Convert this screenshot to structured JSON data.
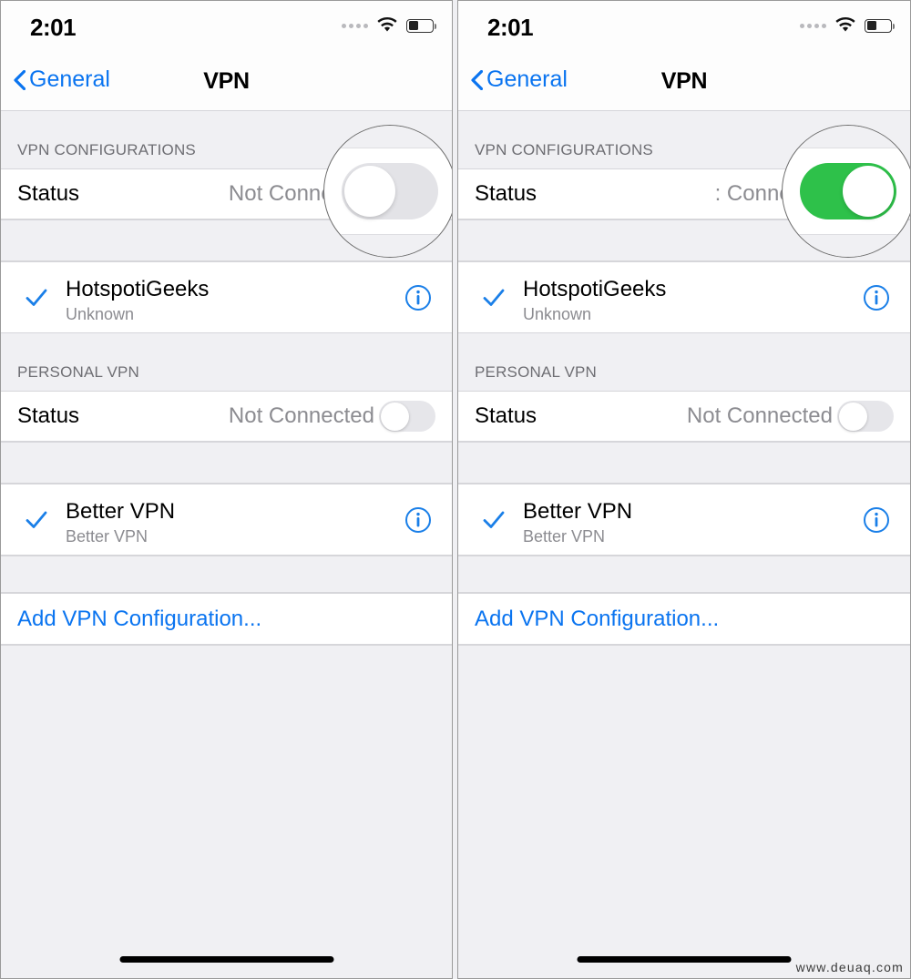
{
  "watermark": "www.deuaq.com",
  "panels": [
    {
      "id": "before",
      "statusbar": {
        "time": "2:01",
        "signal_icon": "signal-dots-icon",
        "wifi_icon": "wifi-icon",
        "battery_icon": "battery-icon"
      },
      "navbar": {
        "back_label": "General",
        "back_icon": "chevron-left-icon",
        "title": "VPN"
      },
      "sections": [
        {
          "header": "VPN CONFIGURATIONS",
          "status_label": "Status",
          "status_value": "Not Connected",
          "toggle_on": false,
          "entry": {
            "name": "HotspotiGeeks",
            "subtitle": "Unknown",
            "check_icon": "checkmark-icon",
            "info_icon": "info-icon"
          }
        },
        {
          "header": "PERSONAL VPN",
          "status_label": "Status",
          "status_value": "Not Connected",
          "toggle_on": false,
          "entry": {
            "name": "Better VPN",
            "subtitle": "Better VPN",
            "check_icon": "checkmark-icon",
            "info_icon": "info-icon"
          }
        }
      ],
      "add_label": "Add VPN Configuration...",
      "lens": {
        "toggle_on": false
      }
    },
    {
      "id": "after",
      "statusbar": {
        "time": "2:01",
        "signal_icon": "signal-dots-icon",
        "wifi_icon": "wifi-icon",
        "battery_icon": "battery-icon"
      },
      "navbar": {
        "back_label": "General",
        "back_icon": "chevron-left-icon",
        "title": "VPN"
      },
      "sections": [
        {
          "header": "VPN CONFIGURATIONS",
          "status_label": "Status",
          "status_value": ": Connected",
          "toggle_on": true,
          "entry": {
            "name": "HotspotiGeeks",
            "subtitle": "Unknown",
            "check_icon": "checkmark-icon",
            "info_icon": "info-icon"
          }
        },
        {
          "header": "PERSONAL VPN",
          "status_label": "Status",
          "status_value": "Not Connected",
          "toggle_on": false,
          "entry": {
            "name": "Better VPN",
            "subtitle": "Better VPN",
            "check_icon": "checkmark-icon",
            "info_icon": "info-icon"
          }
        }
      ],
      "add_label": "Add VPN Configuration...",
      "lens": {
        "toggle_on": true
      }
    }
  ],
  "colors": {
    "accent_blue": "#0a74f0",
    "toggle_green": "#33c04e",
    "toggle_off": "#e6e6ea",
    "group_bg": "#f0f0f3",
    "row_bg": "#ffffff",
    "secondary_text": "#8c8c91"
  }
}
